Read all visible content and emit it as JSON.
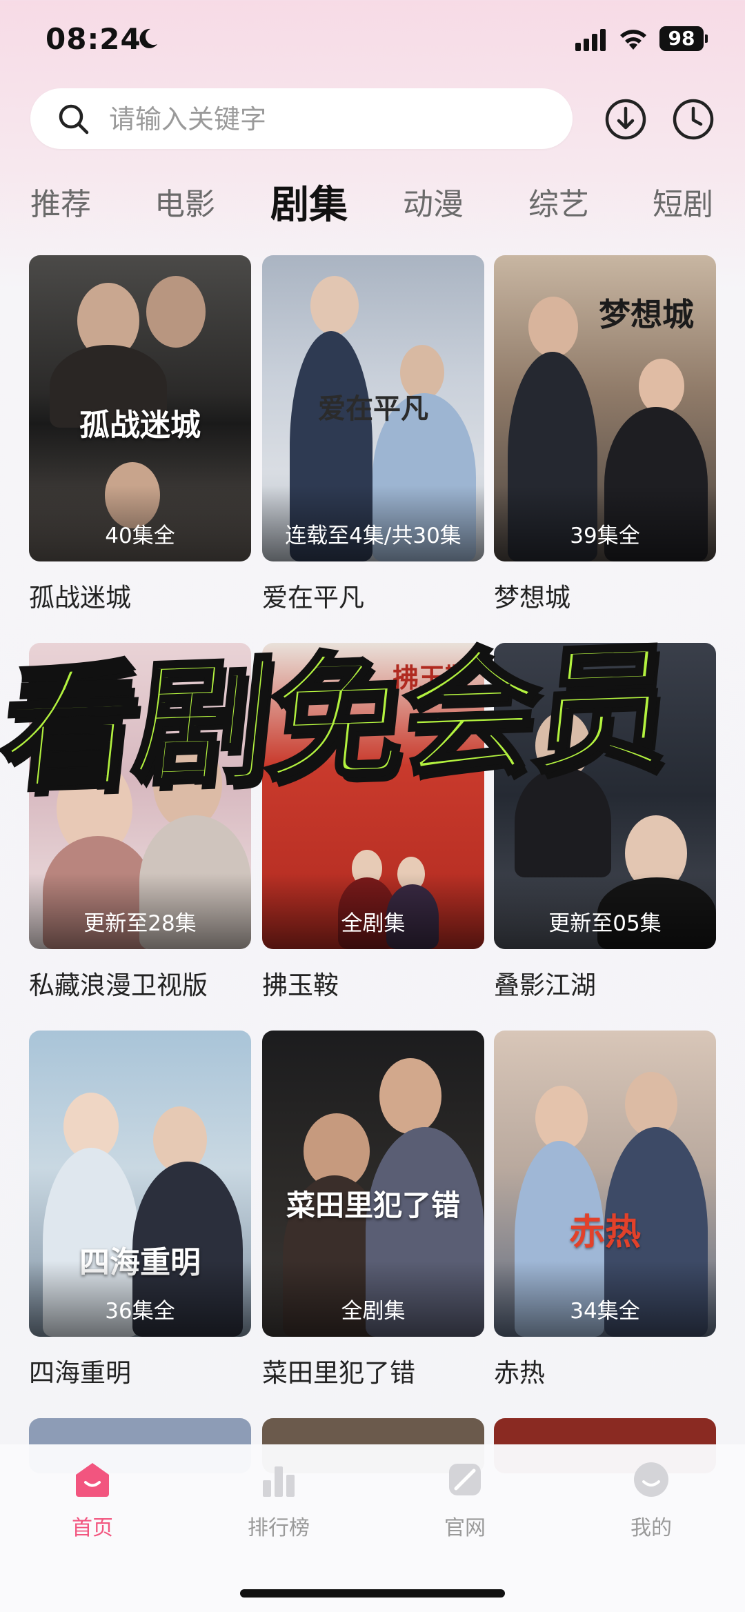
{
  "status_bar": {
    "time": "08:24",
    "battery": "98"
  },
  "search": {
    "placeholder": "请输入关键字"
  },
  "tabs": [
    {
      "label": "推荐"
    },
    {
      "label": "电影"
    },
    {
      "label": "剧集"
    },
    {
      "label": "动漫"
    },
    {
      "label": "综艺"
    },
    {
      "label": "短剧"
    }
  ],
  "active_tab": "剧集",
  "shows": [
    {
      "title": "孤战迷城",
      "badge": "40集全",
      "art": "孤战迷城"
    },
    {
      "title": "爱在平凡",
      "badge": "连载至4集/共30集",
      "art": "爱在平凡"
    },
    {
      "title": "梦想城",
      "badge": "39集全",
      "art": "梦想城"
    },
    {
      "title": "私藏浪漫卫视版",
      "badge": "更新至28集",
      "art": ""
    },
    {
      "title": "拂玉鞍",
      "badge": "全剧集",
      "art": "拂玉鞍"
    },
    {
      "title": "叠影江湖",
      "badge": "更新至05集",
      "art": ""
    },
    {
      "title": "四海重明",
      "badge": "36集全",
      "art": "四海重明"
    },
    {
      "title": "菜田里犯了错",
      "badge": "全剧集",
      "art": "菜田里犯了错"
    },
    {
      "title": "赤热",
      "badge": "34集全",
      "art": "赤热"
    }
  ],
  "promo_overlay": "看剧免会员",
  "bottom_nav": [
    {
      "label": "首页",
      "icon": "home-icon",
      "active": true
    },
    {
      "label": "排行榜",
      "icon": "ranking-icon",
      "active": false
    },
    {
      "label": "官网",
      "icon": "website-icon",
      "active": false
    },
    {
      "label": "我的",
      "icon": "profile-icon",
      "active": false
    }
  ],
  "colors": {
    "accent": "#f2557f",
    "promo": "#b3f23f"
  }
}
